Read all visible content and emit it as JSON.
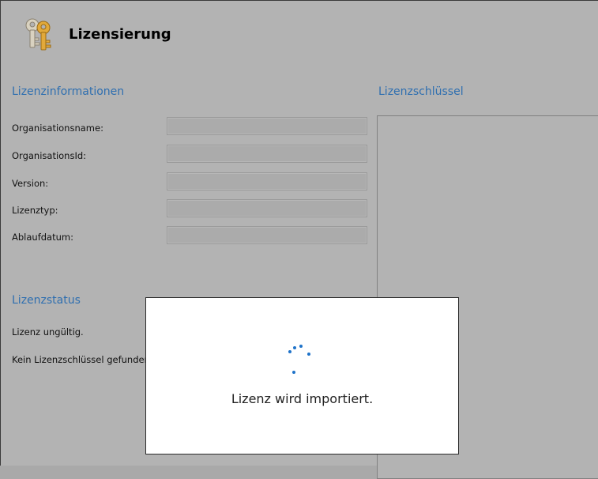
{
  "header": {
    "title": "Lizensierung",
    "icon": "keys-icon"
  },
  "license_info": {
    "title": "Lizenzinformationen",
    "fields": [
      {
        "label": "Organisationsname:",
        "value": ""
      },
      {
        "label": "OrganisationsId:",
        "value": ""
      },
      {
        "label": "Version:",
        "value": ""
      },
      {
        "label": "Lizenztyp:",
        "value": ""
      },
      {
        "label": "Ablaufdatum:",
        "value": ""
      }
    ]
  },
  "license_key": {
    "title": "Lizenzschlüssel",
    "value": ""
  },
  "license_status": {
    "title": "Lizenzstatus",
    "line1": "Lizenz ungültig.",
    "line2": "Kein Lizenzschlüssel gefunden."
  },
  "dialog": {
    "message": "Lizenz wird importiert."
  },
  "colors": {
    "accent": "#2f6fb0",
    "spinner": "#1f73c9",
    "background": "#b3b3b3"
  }
}
